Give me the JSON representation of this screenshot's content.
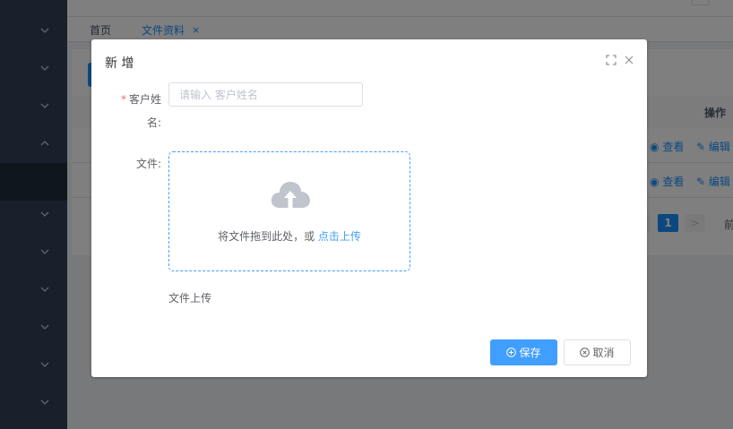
{
  "sidebar": {
    "items": [
      {
        "icon": "chevron-down-icon",
        "glyph": "⌄"
      },
      {
        "icon": "chevron-down-icon",
        "glyph": "⌄"
      },
      {
        "icon": "chevron-down-icon",
        "glyph": "⌄"
      },
      {
        "icon": "chevron-up-icon",
        "glyph": "⌃"
      },
      {
        "icon": "chevron-down-icon",
        "glyph": "⌄"
      },
      {
        "icon": "chevron-down-icon",
        "glyph": "⌄"
      },
      {
        "icon": "chevron-down-icon",
        "glyph": "⌄"
      },
      {
        "icon": "chevron-down-icon",
        "glyph": "⌄"
      },
      {
        "icon": "chevron-down-icon",
        "glyph": "⌄"
      },
      {
        "icon": "chevron-down-icon",
        "glyph": "⌄"
      }
    ]
  },
  "tags": {
    "home": "首页",
    "files": "文件资料",
    "close": "×"
  },
  "table": {
    "actions_header": "操作",
    "rows": [
      {
        "view": "查看",
        "edit": "编辑"
      },
      {
        "view": "查看",
        "edit": "编辑"
      }
    ]
  },
  "pagination": {
    "current_page": "1",
    "next": ">",
    "goto": "前"
  },
  "dialog": {
    "title": "新 增",
    "name_label": "客户姓名:",
    "required_mark": "*",
    "name_placeholder": "请输入 客户姓名",
    "file_label": "文件:",
    "upload_text": "将文件拖到此处，或 ",
    "upload_link": "点击上传",
    "upload_tip": "文件上传",
    "save_label": "保存",
    "cancel_label": "取消"
  },
  "colors": {
    "primary": "#409eff",
    "sidebar": "#304156",
    "required": "#f56c6c"
  }
}
